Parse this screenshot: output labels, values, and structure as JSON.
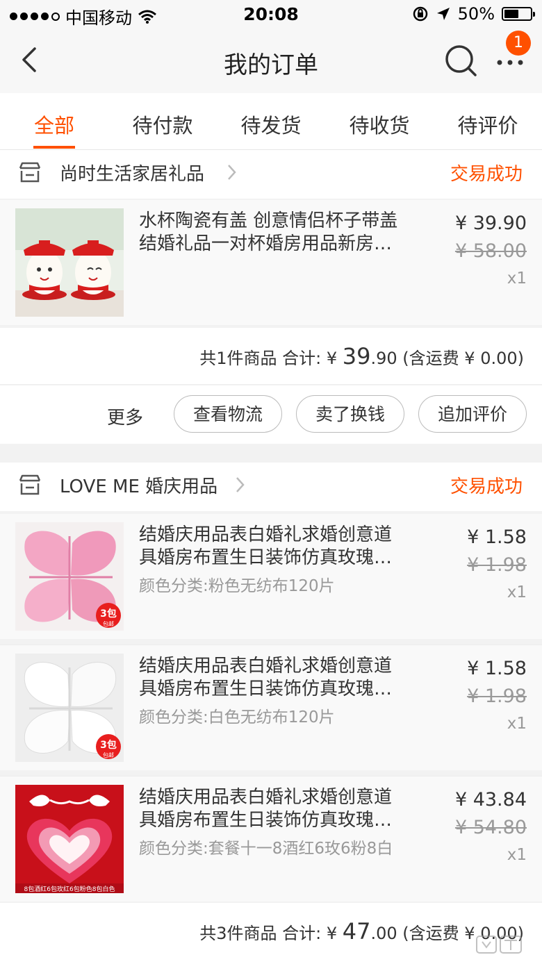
{
  "status_bar": {
    "carrier": "中国移动",
    "time": "20:08",
    "battery": "50%"
  },
  "nav": {
    "title": "我的订单",
    "badge_count": "1"
  },
  "tabs": [
    {
      "label": "全部"
    },
    {
      "label": "待付款"
    },
    {
      "label": "待发货"
    },
    {
      "label": "待收货"
    },
    {
      "label": "待评价"
    }
  ],
  "orders": [
    {
      "shop_name": "尚时生活家居礼品",
      "status": "交易成功",
      "items": [
        {
          "title_line1": "水杯陶瓷有盖 创意情侣杯子带盖",
          "title_line2": "结婚礼品一对杯婚房用品新房…",
          "spec": "",
          "price": "¥ 39.90",
          "original_price": "¥ 58.00",
          "qty": "x1"
        }
      ],
      "summary": {
        "count_text": "共1件商品 合计: ¥ ",
        "total_int": "39",
        "total_dec": ".90",
        "shipping_text": " (含运费 ¥ 0.00)"
      },
      "actions": {
        "more": "更多",
        "logistics": "查看物流",
        "resell": "卖了换钱",
        "review": "追加评价"
      }
    },
    {
      "shop_name": "LOVE ME 婚庆用品",
      "status": "交易成功",
      "items": [
        {
          "title_line1": "结婚庆用品表白婚礼求婚创意道",
          "title_line2": "具婚房布置生日装饰仿真玫瑰…",
          "spec": "颜色分类:粉色无纺布120片",
          "price": "¥ 1.58",
          "original_price": "¥ 1.98",
          "qty": "x1"
        },
        {
          "title_line1": "结婚庆用品表白婚礼求婚创意道",
          "title_line2": "具婚房布置生日装饰仿真玫瑰…",
          "spec": "颜色分类:白色无纺布120片",
          "price": "¥ 1.58",
          "original_price": "¥ 1.98",
          "qty": "x1"
        },
        {
          "title_line1": "结婚庆用品表白婚礼求婚创意道",
          "title_line2": "具婚房布置生日装饰仿真玫瑰…",
          "spec": "颜色分类:套餐十一8酒红6玫6粉8白",
          "price": "¥ 43.84",
          "original_price": "¥ 54.80",
          "qty": "x1"
        }
      ],
      "summary": {
        "count_text": "共3件商品 合计: ¥ ",
        "total_int": "47",
        "total_dec": ".00",
        "shipping_text": " (含运费 ¥ 0.00)"
      }
    }
  ],
  "thumb_labels": {
    "pink_badge": "3包",
    "pink_badge_sub": "包邮",
    "white_badge": "3包",
    "white_badge_sub": "包邮",
    "heart_caption": "8包酒红6包玫红6包粉色8包白色"
  },
  "colors": {
    "accent": "#ff5000",
    "text": "#333333",
    "muted": "#999999"
  }
}
